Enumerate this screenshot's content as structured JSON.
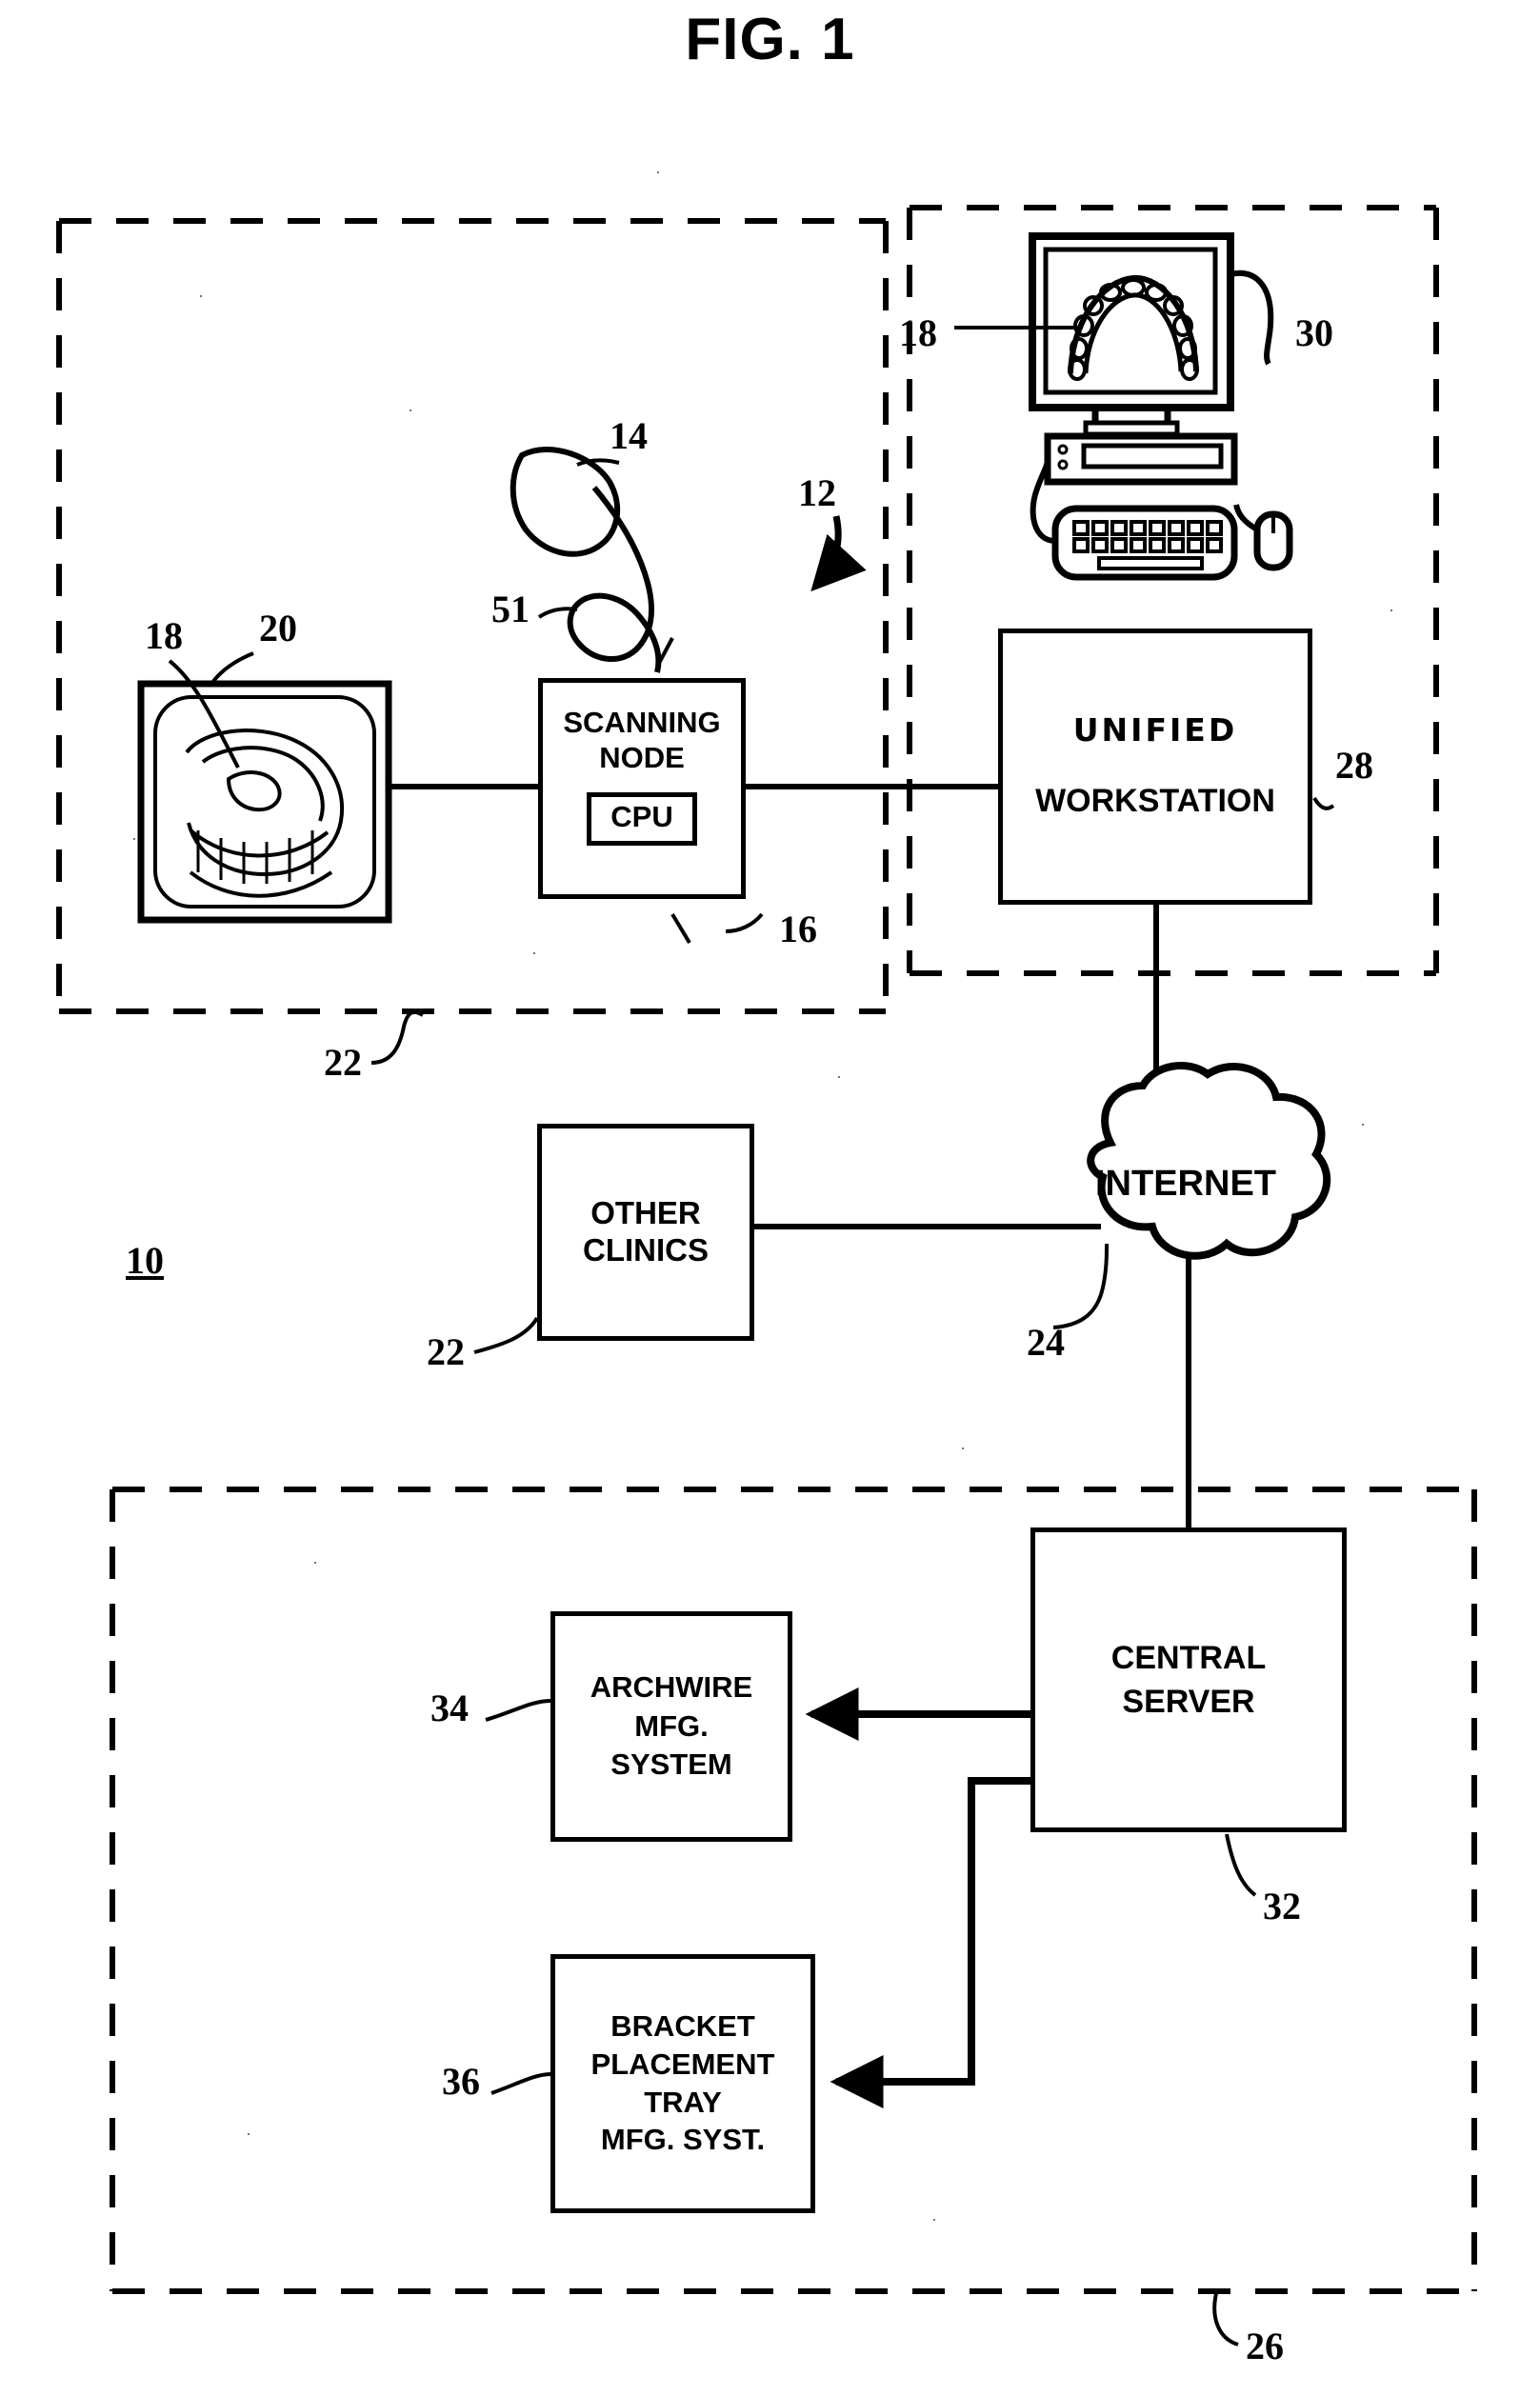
{
  "figure": {
    "title": "FIG. 1",
    "system_numeral": "10"
  },
  "nodes": {
    "scanning_node": {
      "line1": "SCANNING",
      "line2": "NODE",
      "cpu_label": "CPU",
      "numeral": "16"
    },
    "unified_workstation": {
      "line1": "UNIFIED",
      "line2": "WORKSTATION",
      "numeral": "28"
    },
    "other_clinics": {
      "line1": "OTHER",
      "line2": "CLINICS",
      "numeral": "22"
    },
    "internet_cloud": {
      "label": "INTERNET",
      "numeral": "24"
    },
    "central_server": {
      "line1": "CENTRAL",
      "line2": "SERVER",
      "numeral": "32"
    },
    "archwire_mfg": {
      "line1": "ARCHWIRE",
      "line2": "MFG.",
      "line3": "SYSTEM",
      "numeral": "34"
    },
    "bracket_tray_mfg": {
      "line1": "BRACKET",
      "line2": "PLACEMENT",
      "line3": "TRAY",
      "line4": "MFG. SYST.",
      "numeral": "36"
    }
  },
  "illustrations": {
    "dental_model": {
      "numeral_model": "20",
      "numeral_arch": "18"
    },
    "hand_scanner": {
      "numeral_scanner": "14",
      "numeral_cable": "51"
    },
    "workstation_computer": {
      "numeral_monitor": "30",
      "numeral_screen_arch": "18"
    }
  },
  "groupings": {
    "clinic_boundary_numeral": "22",
    "system_arrow_numeral": "12",
    "manufacturing_boundary_numeral": "26"
  },
  "colors": {
    "ink": "#000000",
    "paper": "#ffffff"
  }
}
